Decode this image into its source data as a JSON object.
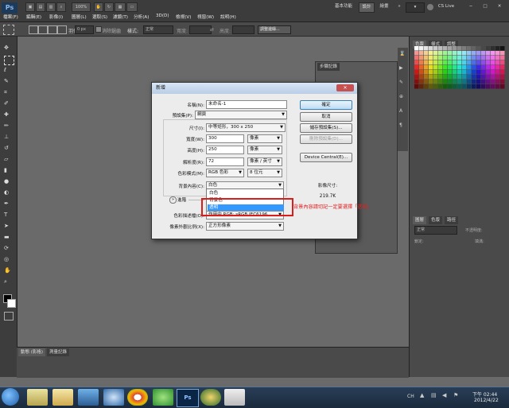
{
  "titlebar": {
    "logo": "Ps",
    "menus": [
      "檔案(F)",
      "編輯(E)",
      "影像(I)",
      "圖層(L)",
      "選取(S)",
      "濾鏡(T)",
      "分析(A)",
      "3D(D)",
      "檢視(V)",
      "視窗(W)",
      "說明(H)"
    ],
    "zoom": "100%",
    "workspaces": [
      "基本功能",
      "設計",
      "繪畫"
    ],
    "active_workspace": "設計",
    "more": "»",
    "cslive": "CS Live",
    "window_controls": [
      "−",
      "□",
      "✕"
    ]
  },
  "options": {
    "feather_value": "0 px",
    "antialias_label": "消除鋸齒",
    "style_label": "樣式:",
    "style_value": "正常",
    "width_label": "寬度:",
    "height_label": "高度:",
    "refine_button": "調整邊緣..."
  },
  "panels": {
    "swatch_tabs": [
      "色票",
      "樣式",
      "調整"
    ],
    "history_title": "步驟記錄",
    "layers_tabs": [
      "圖層",
      "色版",
      "路徑"
    ],
    "blend_mode": "正常",
    "opacity_label": "不透明度:",
    "lock_label": "鎖定:",
    "fill_label": "填滿:",
    "bottom_tabs": [
      "動態 (影格)",
      "測量記錄"
    ]
  },
  "dialog": {
    "title": "新增",
    "close": "✕",
    "name_label": "名稱(N):",
    "name_value": "未命名-1",
    "preset_label": "預設集(P):",
    "preset_value": "網頁",
    "size_label": "尺寸(I):",
    "size_value": "中等矩形，300 x 250",
    "width_label": "寬度(W):",
    "width_value": "300",
    "width_unit": "像素",
    "height_label": "高度(H):",
    "height_value": "250",
    "height_unit": "像素",
    "res_label": "解析度(R):",
    "res_value": "72",
    "res_unit": "像素 / 英寸",
    "mode_label": "色彩模式(M):",
    "mode_value": "RGB 色彩",
    "bits_value": "8 位元",
    "bg_label": "背景內容(C):",
    "bg_value": "白色",
    "bg_options": [
      "白色",
      "背景色",
      "透明"
    ],
    "bg_selected": "透明",
    "advanced_label": "進階",
    "profile_label": "色彩描述檔(O):",
    "profile_value": "作用中 RGB: sRGB IEC6196...",
    "aspect_label": "像素外觀比例(X):",
    "aspect_value": "正方形像素",
    "ok": "確定",
    "cancel": "取消",
    "save_preset": "儲存預設集(S)...",
    "delete_preset": "刪除預設集(D)...",
    "device_central": "Device Central(E)...",
    "image_size_label": "影像尺寸:",
    "image_size_value": "219.7K"
  },
  "annotation": "背景內容請切記一定要選擇「透明」",
  "taskbar": {
    "lang": "CH",
    "time": "下午 02:44",
    "date": "2012/4/22"
  },
  "colors": {
    "accent_red": "#d81d1d",
    "selection_blue": "#3399ff",
    "workspace_bg": "#6a6a6a"
  }
}
